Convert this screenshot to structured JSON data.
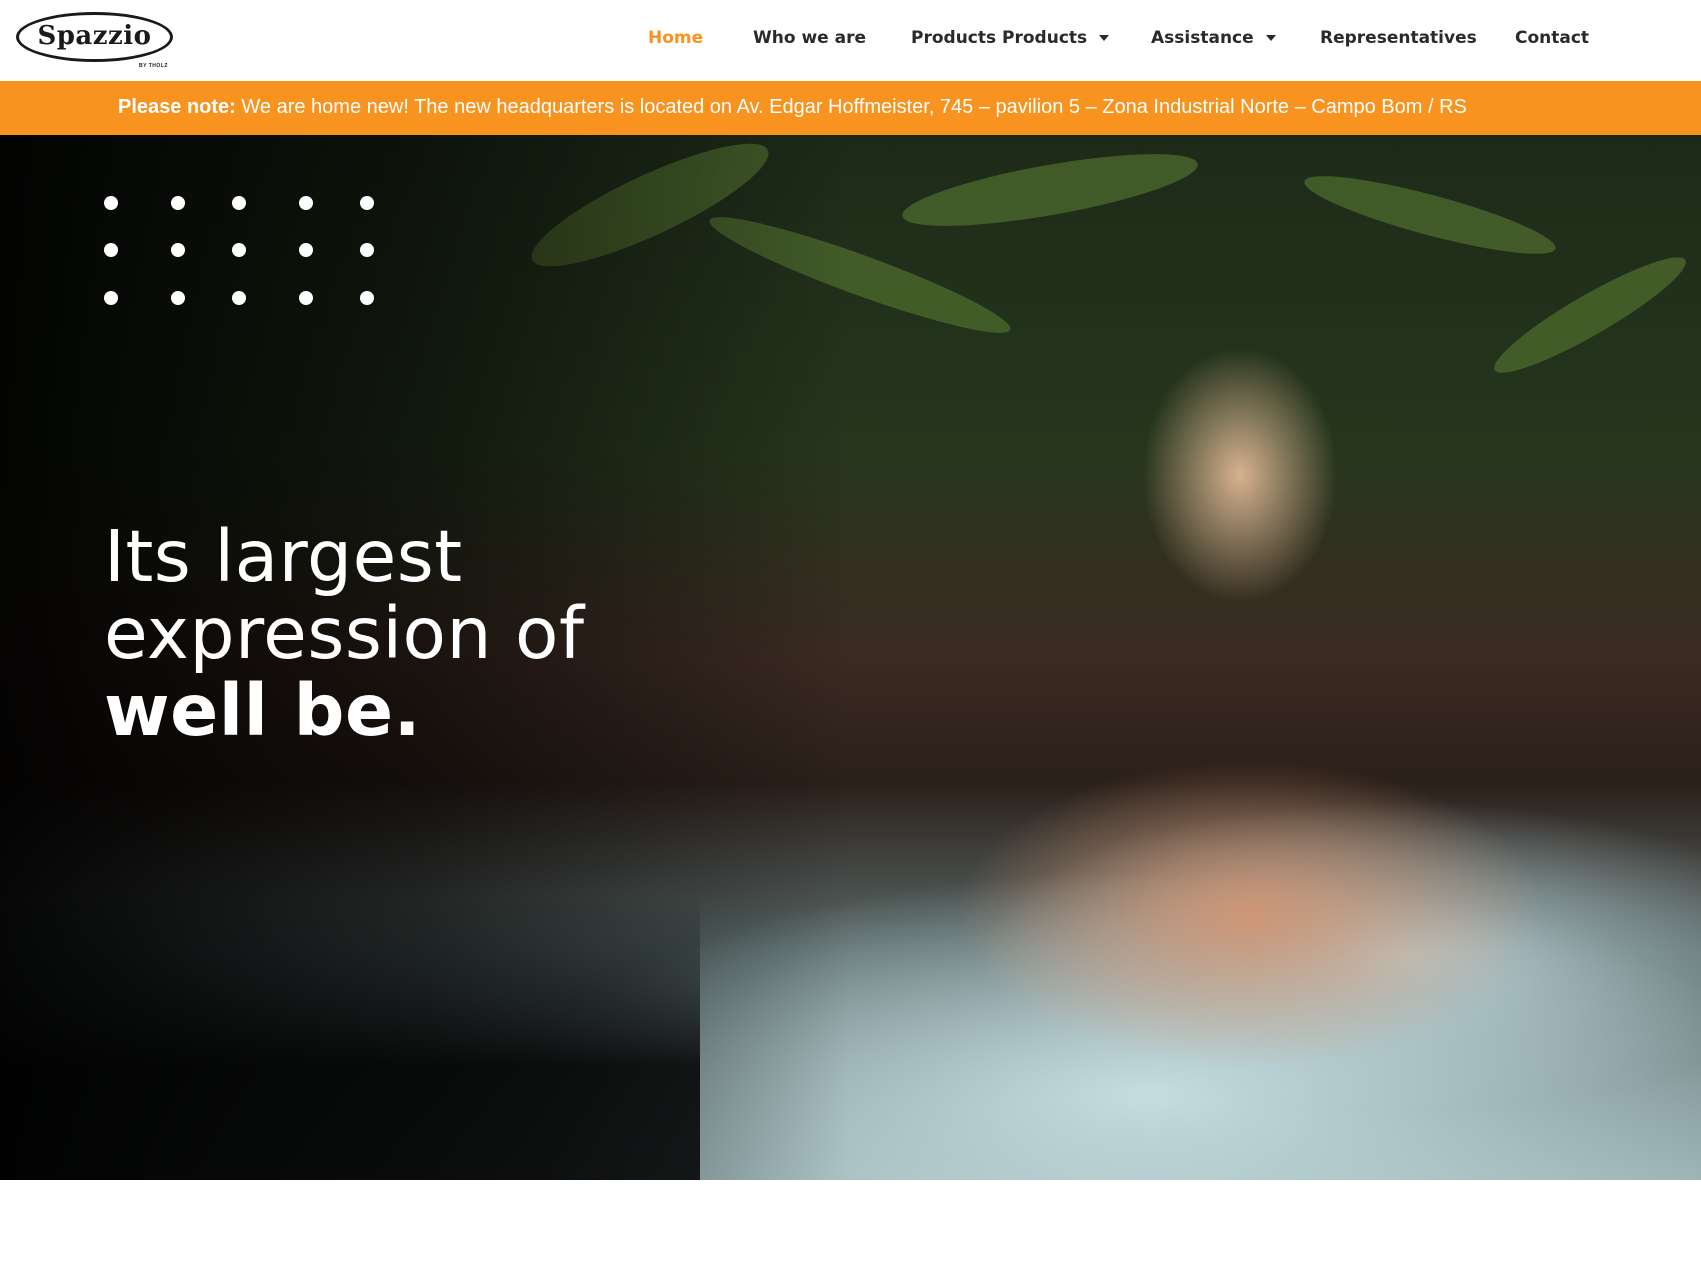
{
  "brand": {
    "logo_text": "Spazzio",
    "logo_sub": "BY THOLZ",
    "accent_color": "#f7931e"
  },
  "nav": {
    "items": [
      {
        "label": "Home",
        "active": true,
        "has_dropdown": false
      },
      {
        "label": "Who we are",
        "active": false,
        "has_dropdown": false
      },
      {
        "label": "Products Products",
        "active": false,
        "has_dropdown": true
      },
      {
        "label": "Assistance",
        "active": false,
        "has_dropdown": true
      },
      {
        "label": "Representatives",
        "active": false,
        "has_dropdown": false
      },
      {
        "label": "Contact",
        "active": false,
        "has_dropdown": false
      }
    ]
  },
  "notice": {
    "label": "Please note:",
    "text": "We are home new! The new headquarters is located on Av. Edgar Hoffmeister, 745 – pavilion 5 – Zona Industrial Norte – Campo Bom / RS"
  },
  "hero": {
    "headline_line1": "Its largest",
    "headline_line2": "expression of",
    "headline_line3": "well be.",
    "dot_icon": "dots-grid-icon"
  }
}
